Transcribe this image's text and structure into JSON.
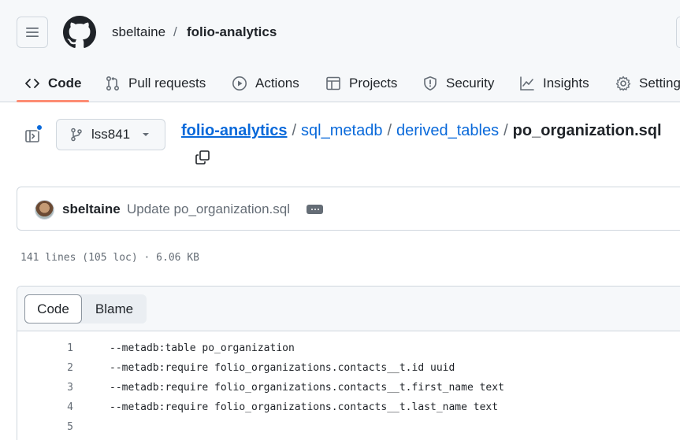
{
  "header": {
    "owner": "sbeltaine",
    "separator": "/",
    "repo": "folio-analytics"
  },
  "tabs": [
    {
      "label": "Code",
      "icon": "code-icon",
      "active": true
    },
    {
      "label": "Pull requests",
      "icon": "pull-request-icon"
    },
    {
      "label": "Actions",
      "icon": "play-icon"
    },
    {
      "label": "Projects",
      "icon": "table-icon"
    },
    {
      "label": "Security",
      "icon": "shield-icon"
    },
    {
      "label": "Insights",
      "icon": "graph-icon"
    },
    {
      "label": "Settings",
      "icon": "gear-icon"
    }
  ],
  "branch": {
    "name": "lss841"
  },
  "breadcrumb": {
    "repo": "folio-analytics",
    "dir1": "sql_metadb",
    "dir2": "derived_tables",
    "file": "po_organization.sql",
    "sep": "/"
  },
  "commit": {
    "author": "sbeltaine",
    "message": "Update po_organization.sql"
  },
  "file_meta": "141 lines (105 loc) · 6.06 KB",
  "view_toggle": {
    "code": "Code",
    "blame": "Blame"
  },
  "code_lines": [
    {
      "num": "1",
      "text": "--metadb:table po_organization"
    },
    {
      "num": "2",
      "text": "--metadb:require folio_organizations.contacts__t.id uuid"
    },
    {
      "num": "3",
      "text": "--metadb:require folio_organizations.contacts__t.first_name text"
    },
    {
      "num": "4",
      "text": "--metadb:require folio_organizations.contacts__t.last_name text"
    },
    {
      "num": "5",
      "text": ""
    }
  ]
}
